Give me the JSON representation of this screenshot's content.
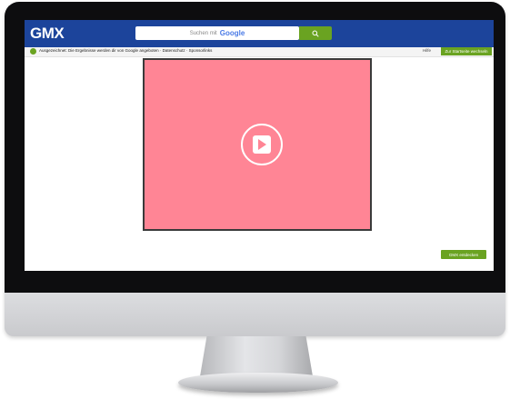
{
  "header": {
    "logo": "GMX",
    "search_prefix": "Suchen mit",
    "search_provider": "Google"
  },
  "subbar": {
    "notice": "Ausgezeichnet: Die Ergebnisse werden dir von Google angeboten · Datenschutz · Sponsorlinks",
    "right_link": "Hilfe",
    "button_label": "Zur Startseite wechseln"
  },
  "video": {
    "background_color": "#ff8595"
  },
  "action_button": {
    "label": "GMX entdecken"
  },
  "colors": {
    "header_blue": "#1c449b",
    "accent_green": "#6aa321",
    "video_pink": "#ff8595"
  }
}
